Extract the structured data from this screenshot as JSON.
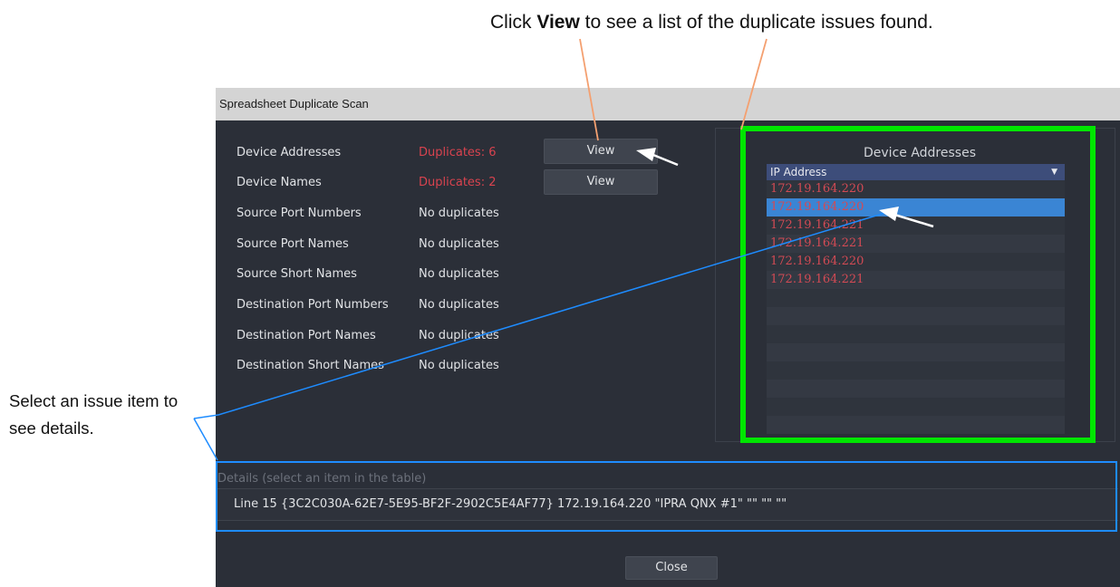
{
  "annotations": {
    "top_pre": "Click ",
    "top_bold": "View",
    "top_post": " to see a list of the duplicate issues found.",
    "left": "Select an issue item to see details."
  },
  "dialog": {
    "title": "Spreadsheet Duplicate Scan",
    "rows": [
      {
        "label": "Device Addresses",
        "status": "Duplicates: 6"
      },
      {
        "label": "Device Names",
        "status": "Duplicates: 2"
      },
      {
        "label": "Source Port Numbers",
        "status": "No duplicates"
      },
      {
        "label": "Source Port Names",
        "status": "No duplicates"
      },
      {
        "label": "Source Short Names",
        "status": "No duplicates"
      },
      {
        "label": "Destination Port Numbers",
        "status": "No duplicates"
      },
      {
        "label": "Destination Port Names",
        "status": "No duplicates"
      },
      {
        "label": "Destination Short Names",
        "status": "No duplicates"
      }
    ],
    "view_label": "View",
    "panel": {
      "title": "Device Addresses",
      "column_header": "IP Address",
      "rows": [
        "172.19.164.220",
        "172.19.164.220",
        "172.19.164.221",
        "172.19.164.221",
        "172.19.164.220",
        "172.19.164.221"
      ]
    },
    "details_label": "Details (select an item in the table)",
    "details_text": "Line 15   {3C2C030A-62E7-5E95-BF2F-2902C5E4AF77}   172.19.164.220   \"IPRA QNX #1\"   \"\"   \"\"   \"\"",
    "close_label": "Close"
  },
  "colors": {
    "dialog_bg": "#2b2f38",
    "duplicate_text": "#d9434f",
    "selection": "#3a85d4",
    "highlight_green": "#00e600",
    "highlight_blue": "#1e8cff",
    "callout_line": "#f4a070"
  }
}
